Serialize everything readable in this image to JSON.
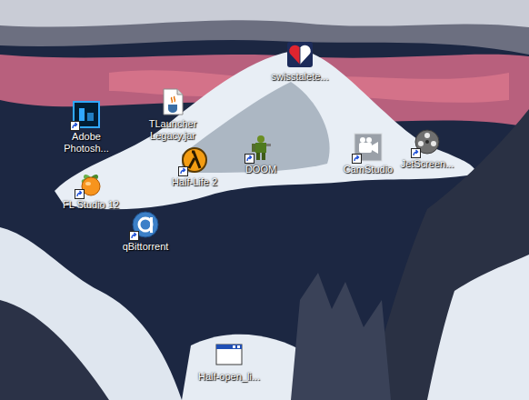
{
  "desktop": {
    "icons": [
      {
        "label": "swisstalete...",
        "shortcut": false
      },
      {
        "label": "TLauncher Legacy.jar",
        "shortcut": false
      },
      {
        "label": "Adobe Photosh...",
        "shortcut": true
      },
      {
        "label": "Half-Life 2",
        "shortcut": true
      },
      {
        "label": "DOOM",
        "shortcut": true
      },
      {
        "label": "CamStudio",
        "shortcut": true
      },
      {
        "label": "JetScreen...",
        "shortcut": true
      },
      {
        "label": "FL Studio 12",
        "shortcut": true
      },
      {
        "label": "qBittorrent",
        "shortcut": true
      },
      {
        "label": "Half-open_li...",
        "shortcut": false
      }
    ]
  }
}
